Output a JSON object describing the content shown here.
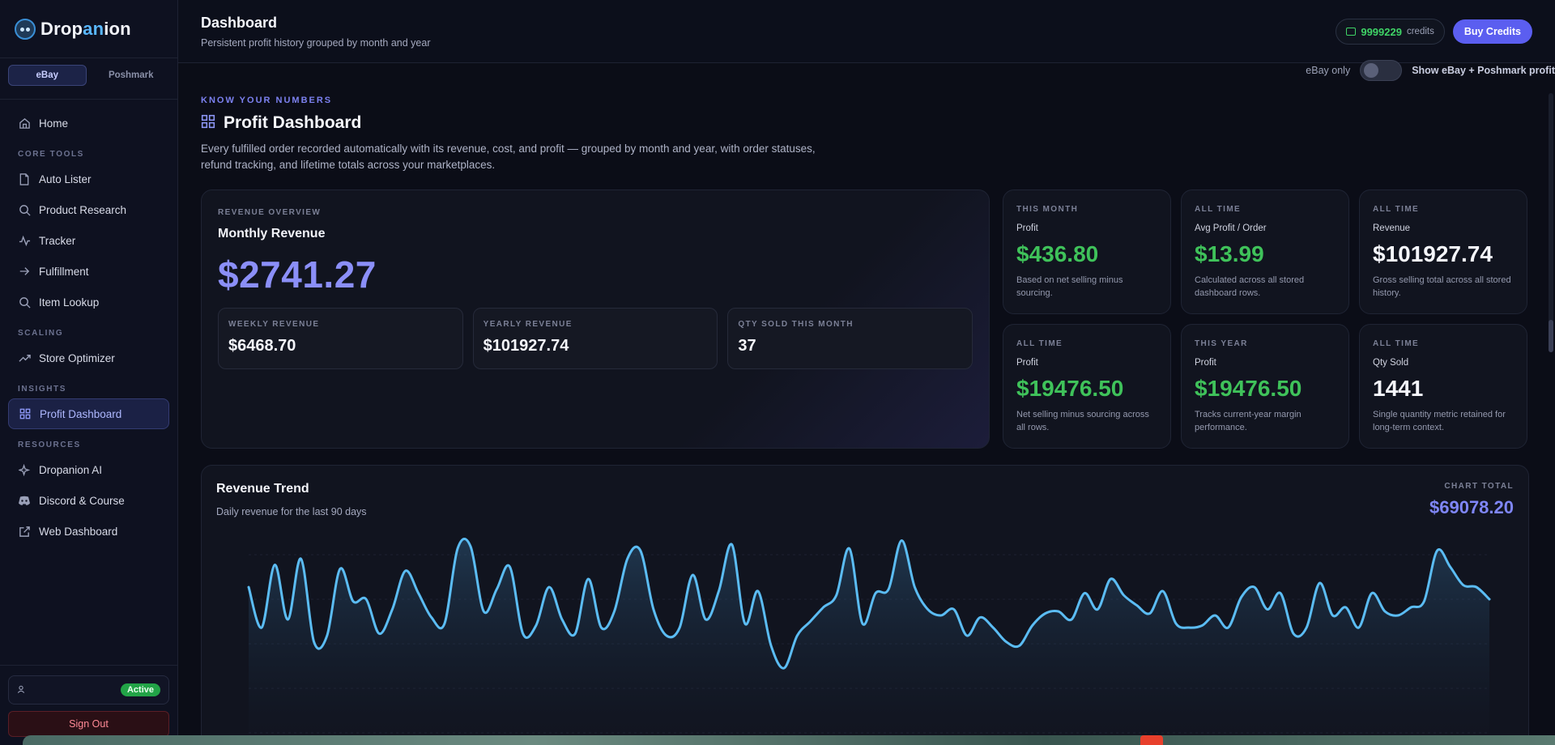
{
  "brand": {
    "name_part1": "Drop",
    "name_accent": "an",
    "name_part2": "ion"
  },
  "marketplaces": [
    "eBay",
    "Poshmark"
  ],
  "sidebar": {
    "home": "Home",
    "sections": {
      "core": "CORE TOOLS",
      "scaling": "SCALING",
      "insights": "INSIGHTS",
      "resources": "RESOURCES"
    },
    "core_items": [
      "Auto Lister",
      "Product Research",
      "Tracker",
      "Fulfillment",
      "Item Lookup"
    ],
    "scaling_items": [
      "Store Optimizer"
    ],
    "insights_items": [
      "Profit Dashboard"
    ],
    "resources_items": [
      "Dropanion AI",
      "Discord & Course",
      "Web Dashboard"
    ],
    "status_badge": "Active",
    "sign_out": "Sign Out"
  },
  "header": {
    "title": "Dashboard",
    "subtitle": "Persistent profit history grouped by month and year",
    "credits_value": "9999229",
    "credits_label": "credits",
    "buy_label": "Buy Credits",
    "toggle_left": "eBay only",
    "toggle_right": "Show eBay + Poshmark profit"
  },
  "page": {
    "eyebrow": "KNOW YOUR NUMBERS",
    "title": "Profit Dashboard",
    "description": "Every fulfilled order recorded automatically with its revenue, cost, and profit — grouped by month and year, with order statuses, refund tracking, and lifetime totals across your marketplaces."
  },
  "revenue_overview": {
    "label": "REVENUE OVERVIEW",
    "title": "Monthly Revenue",
    "value": "$2741.27",
    "minis": [
      {
        "label": "WEEKLY REVENUE",
        "value": "$6468.70"
      },
      {
        "label": "YEARLY REVENUE",
        "value": "$101927.74"
      },
      {
        "label": "QTY SOLD THIS MONTH",
        "value": "37"
      }
    ]
  },
  "stats": [
    {
      "period": "THIS MONTH",
      "title": "Profit",
      "value": "$436.80",
      "note": "Based on net selling minus sourcing."
    },
    {
      "period": "ALL TIME",
      "title": "Avg Profit / Order",
      "value": "$13.99",
      "note": "Calculated across all stored dashboard rows."
    },
    {
      "period": "ALL TIME",
      "title": "Revenue",
      "value": "$101927.74",
      "note": "Gross selling total across all stored history."
    },
    {
      "period": "ALL TIME",
      "title": "Profit",
      "value": "$19476.50",
      "note": "Net selling minus sourcing across all rows."
    },
    {
      "period": "THIS YEAR",
      "title": "Profit",
      "value": "$19476.50",
      "note": "Tracks current-year margin performance."
    },
    {
      "period": "ALL TIME",
      "title": "Qty Sold",
      "value": "1441",
      "note": "Single quantity metric retained for long-term context."
    }
  ],
  "trend": {
    "title": "Revenue Trend",
    "subtitle": "Daily revenue for the last 90 days",
    "total_label": "CHART TOTAL",
    "total_value": "$69078.20"
  },
  "colors": {
    "accent": "#5b5ef0",
    "green": "#3fc25a",
    "line": "#5bbcf3"
  },
  "chart_data": {
    "type": "area",
    "title": "Revenue Trend",
    "values": [
      720,
      520,
      830,
      560,
      860,
      450,
      480,
      810,
      650,
      660,
      490,
      610,
      800,
      690,
      570,
      540,
      910,
      920,
      600,
      710,
      820,
      490,
      530,
      720,
      560,
      490,
      760,
      520,
      600,
      860,
      900,
      610,
      480,
      520,
      780,
      560,
      700,
      930,
      540,
      700,
      430,
      320,
      480,
      550,
      620,
      680,
      910,
      540,
      690,
      710,
      950,
      720,
      610,
      580,
      610,
      480,
      570,
      520,
      450,
      430,
      530,
      590,
      600,
      560,
      690,
      610,
      760,
      680,
      630,
      590,
      700,
      540,
      520,
      530,
      580,
      520,
      670,
      720,
      610,
      690,
      490,
      520,
      740,
      580,
      620,
      520,
      690,
      600,
      580,
      620,
      650,
      900,
      820,
      730,
      720,
      660
    ]
  }
}
